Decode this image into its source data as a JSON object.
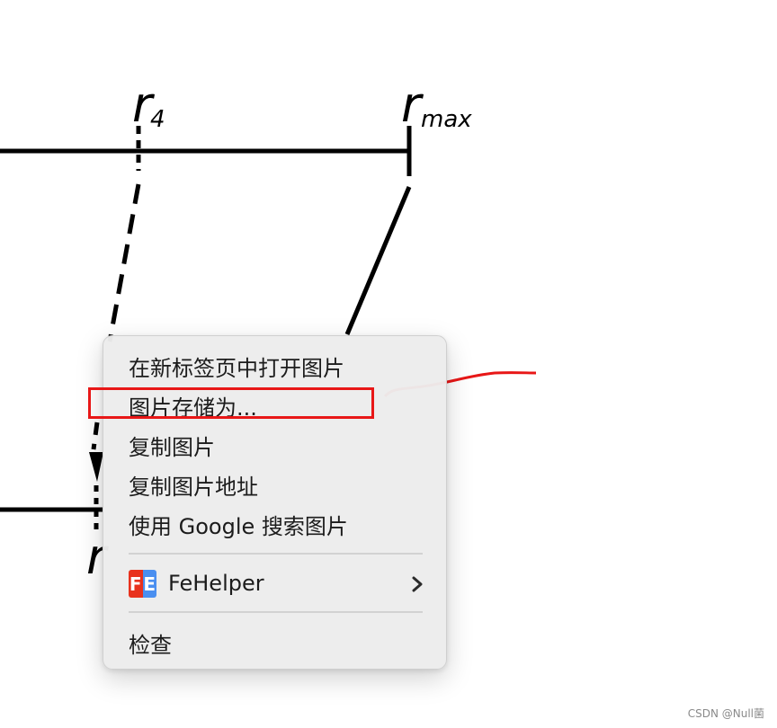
{
  "diagram": {
    "label_r4_main": "r",
    "label_r4_sub": "4",
    "label_rmax_main": "r",
    "label_rmax_sub": "max",
    "label_r_bottom": "r"
  },
  "context_menu": {
    "items": [
      {
        "label": "在新标签页中打开图片"
      },
      {
        "label": "图片存储为..."
      },
      {
        "label": "复制图片"
      },
      {
        "label": "复制图片地址"
      },
      {
        "label": "使用 Google 搜索图片"
      }
    ],
    "extension": {
      "label": "FeHelper",
      "icon_left": "F",
      "icon_right": "E",
      "icon": "fehelper-icon",
      "submenu_icon": "chevron-right-icon"
    },
    "inspect_label": "检查"
  },
  "annotation": {
    "highlight_color": "#e81717",
    "highlighted_item": "图片存储为..."
  },
  "watermark": "CSDN @Null菌"
}
